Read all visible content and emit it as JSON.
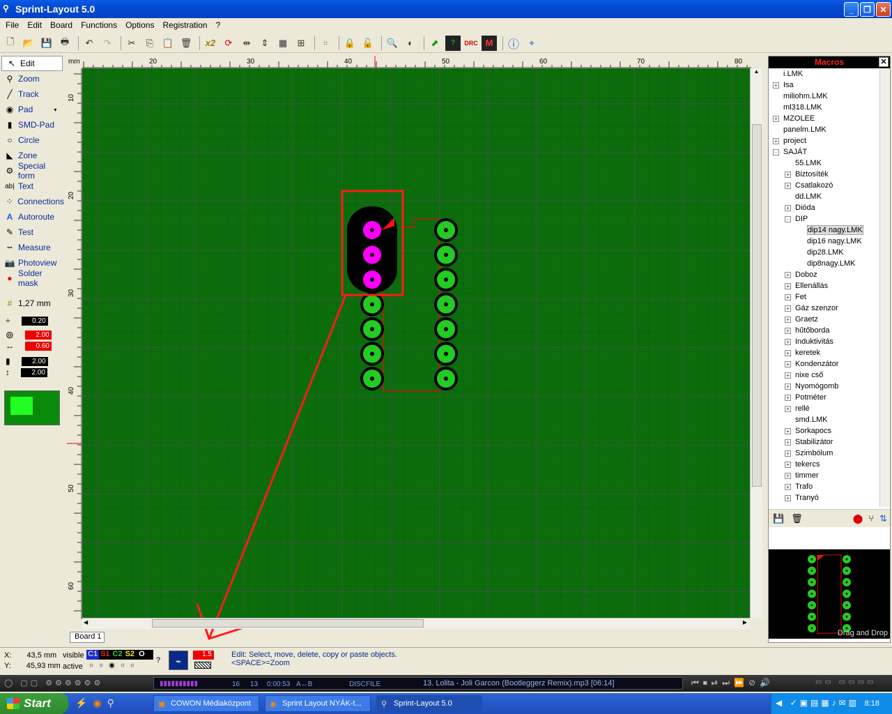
{
  "window": {
    "title": "Sprint-Layout 5.0"
  },
  "menu": [
    "File",
    "Edit",
    "Board",
    "Functions",
    "Options",
    "Registration",
    "?"
  ],
  "toolbar_icons": [
    "new-icon",
    "open-icon",
    "save-icon",
    "print-icon",
    "undo-icon",
    "redo-icon",
    "cut-icon",
    "copy-icon",
    "paste-icon",
    "delete-icon",
    "x2-icon",
    "rotate-icon",
    "mirror-h-icon",
    "mirror-v-icon",
    "group-icon",
    "align-icon",
    "snap-icon",
    "lock-icon",
    "unlock-icon",
    "zoom-icon",
    "layer-icon",
    "export-icon",
    "test-icon",
    "drc-icon",
    "macro-icon",
    "info-icon",
    "crop-icon"
  ],
  "toolbar": {
    "x2_label": "x2"
  },
  "tools": [
    {
      "label": "Edit",
      "icon": "arrow-icon",
      "active": true
    },
    {
      "label": "Zoom",
      "icon": "magnifier-icon"
    },
    {
      "label": "Track",
      "icon": "track-icon"
    },
    {
      "label": "Pad",
      "icon": "pad-icon",
      "dropdown": true
    },
    {
      "label": "SMD-Pad",
      "icon": "smd-pad-icon"
    },
    {
      "label": "Circle",
      "icon": "circle-icon"
    },
    {
      "label": "Zone",
      "icon": "zone-icon"
    },
    {
      "label": "Special form",
      "icon": "special-form-icon"
    },
    {
      "label": "Text",
      "icon": "text-icon"
    },
    {
      "label": "Connections",
      "icon": "connections-icon"
    },
    {
      "label": "Autoroute",
      "icon": "autoroute-icon"
    },
    {
      "label": "Test",
      "icon": "test-icon"
    },
    {
      "label": "Measure",
      "icon": "measure-icon"
    },
    {
      "label": "Photoview",
      "icon": "camera-icon"
    },
    {
      "label": "Solder mask",
      "icon": "solder-mask-icon"
    }
  ],
  "grid": {
    "label": "1,27 mm"
  },
  "params": {
    "track_width": "0.20",
    "pad_outer": "2.00",
    "pad_inner": "0.60",
    "smd_w": "2.00",
    "smd_h": "2.00"
  },
  "ruler": {
    "unit": "mm",
    "top": [
      "20",
      "30",
      "40",
      "50",
      "60",
      "70",
      "80"
    ],
    "left": [
      "10",
      "20",
      "30",
      "40",
      "50",
      "60"
    ]
  },
  "board": {
    "tab": "Board 1"
  },
  "macros": {
    "title": "Macros",
    "items": [
      {
        "label": "i.LMK",
        "level": 0,
        "expander": ""
      },
      {
        "label": "Isa",
        "level": 0,
        "expander": "+"
      },
      {
        "label": "miliohm.LMK",
        "level": 0,
        "expander": ""
      },
      {
        "label": "ml318.LMK",
        "level": 0,
        "expander": ""
      },
      {
        "label": "MZOLEE",
        "level": 0,
        "expander": "+"
      },
      {
        "label": "panelm.LMK",
        "level": 0,
        "expander": ""
      },
      {
        "label": "project",
        "level": 0,
        "expander": "+"
      },
      {
        "label": "SAJÁT",
        "level": 0,
        "expander": "-"
      },
      {
        "label": "55.LMK",
        "level": 1,
        "expander": ""
      },
      {
        "label": "Biztosíték",
        "level": 1,
        "expander": "+"
      },
      {
        "label": "Csatlakozó",
        "level": 1,
        "expander": "+"
      },
      {
        "label": "dd.LMK",
        "level": 1,
        "expander": ""
      },
      {
        "label": "Dióda",
        "level": 1,
        "expander": "+"
      },
      {
        "label": "DIP",
        "level": 1,
        "expander": "-"
      },
      {
        "label": "dip14 nagy.LMK",
        "level": 2,
        "expander": "",
        "selected": true
      },
      {
        "label": "dip16 nagy.LMK",
        "level": 2,
        "expander": ""
      },
      {
        "label": "dip28.LMK",
        "level": 2,
        "expander": ""
      },
      {
        "label": "dip8nagy.LMK",
        "level": 2,
        "expander": ""
      },
      {
        "label": "Doboz",
        "level": 1,
        "expander": "+"
      },
      {
        "label": "Ellenállás",
        "level": 1,
        "expander": "+"
      },
      {
        "label": "Fet",
        "level": 1,
        "expander": "+"
      },
      {
        "label": "Gáz szenzor",
        "level": 1,
        "expander": "+"
      },
      {
        "label": "Graetz",
        "level": 1,
        "expander": "+"
      },
      {
        "label": "hűtőborda",
        "level": 1,
        "expander": "+"
      },
      {
        "label": "Induktivitás",
        "level": 1,
        "expander": "+"
      },
      {
        "label": "keretek",
        "level": 1,
        "expander": "+"
      },
      {
        "label": "Kondenzátor",
        "level": 1,
        "expander": "+"
      },
      {
        "label": "nixe cső",
        "level": 1,
        "expander": "+"
      },
      {
        "label": "Nyomógomb",
        "level": 1,
        "expander": "+"
      },
      {
        "label": "Potméter",
        "level": 1,
        "expander": "+"
      },
      {
        "label": "rellé",
        "level": 1,
        "expander": "+"
      },
      {
        "label": "smd.LMK",
        "level": 1,
        "expander": ""
      },
      {
        "label": "Sorkapocs",
        "level": 1,
        "expander": "+"
      },
      {
        "label": "Stabilizátor",
        "level": 1,
        "expander": "+"
      },
      {
        "label": "Szimbólum",
        "level": 1,
        "expander": "+"
      },
      {
        "label": "tekercs",
        "level": 1,
        "expander": "+"
      },
      {
        "label": "timmer",
        "level": 1,
        "expander": "+"
      },
      {
        "label": "Trafo",
        "level": 1,
        "expander": "+"
      },
      {
        "label": "Tranyó",
        "level": 1,
        "expander": "+"
      }
    ],
    "preview_caption": "Drag and Drop"
  },
  "status": {
    "x_label": "X:",
    "x_value": "43,5 mm",
    "y_label": "Y:",
    "y_value": "45,93 mm",
    "visible_label": "visible",
    "active_label": "active",
    "layers": [
      "C1",
      "S1",
      "C2",
      "S2",
      "O"
    ],
    "question": "?",
    "track_value": "1.5",
    "hint1": "Edit: Select, move, delete, copy or paste objects.",
    "hint2": "<SPACE>=Zoom"
  },
  "player": {
    "counter1": "16",
    "counter2": "13",
    "time": "0:00:53",
    "ab": "A↔B",
    "disc": "DISC",
    "file": "FILE",
    "track": "13. Lolita - Joli Garcon (Bootleggerz Remix).mp3  [06:14]"
  },
  "taskbar": {
    "start": "Start",
    "tasks": [
      "COWON Médiaközpont",
      "Sprint Layout NYÁK-t...",
      "Sprint-Layout 5.0"
    ],
    "clock": "8:18"
  },
  "colors": {
    "board": "#0b6e0b",
    "grid": "#6e3a7a",
    "pad_green": "#22cc22",
    "pad_magenta": "#ff00ff",
    "annotation": "#ff1a1a"
  }
}
